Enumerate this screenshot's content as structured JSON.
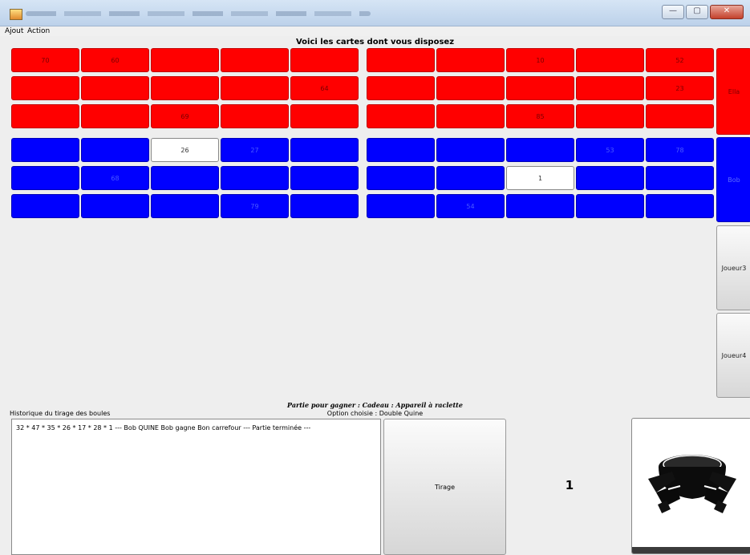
{
  "menu": {
    "items": [
      "Ajout",
      "Action"
    ]
  },
  "window": {
    "controls": [
      "—",
      "▢",
      "✕"
    ]
  },
  "board": {
    "title": "Voici les cartes dont vous disposez",
    "cards": [
      {
        "color": "red",
        "rows": [
          [
            "70",
            "60",
            "",
            "",
            "",
            "",
            "",
            "10",
            "",
            "52"
          ],
          [
            "",
            "",
            "",
            "",
            "64",
            "",
            "",
            "",
            "",
            "23"
          ],
          [
            "",
            "",
            "69",
            "",
            "",
            "",
            "",
            "85",
            "",
            ""
          ]
        ]
      },
      {
        "color": "blue",
        "rows": [
          [
            "",
            "",
            "26",
            "27",
            "",
            "",
            "",
            "",
            "53",
            "78"
          ],
          [
            "",
            "68",
            "",
            "",
            "",
            "",
            "",
            "1",
            "",
            ""
          ],
          [
            "",
            "",
            "",
            "79",
            "",
            "",
            "54",
            "",
            "",
            ""
          ]
        ]
      }
    ],
    "marked": [
      [
        0,
        2
      ],
      [
        1,
        7
      ]
    ]
  },
  "players": [
    {
      "label": "Ella",
      "color": "red"
    },
    {
      "label": "Bob",
      "color": "blue"
    },
    {
      "label": "Joueur3",
      "color": "grey"
    },
    {
      "label": "Joueur4",
      "color": "grey"
    }
  ],
  "game": {
    "partie_label": "Partie pour gagner : Cadeau : Appareil à raclette",
    "option_label": "Option choisie : Double Quine",
    "history_label": "Historique du tirage des boules",
    "history_text": "32 * 47 * 35 * 26 * 17 * 28 * 1 --- Bob QUINE  Bob gagne Bon carrefour --- Partie terminée ---",
    "tirage_label": "Tirage",
    "last_draw": "1"
  }
}
